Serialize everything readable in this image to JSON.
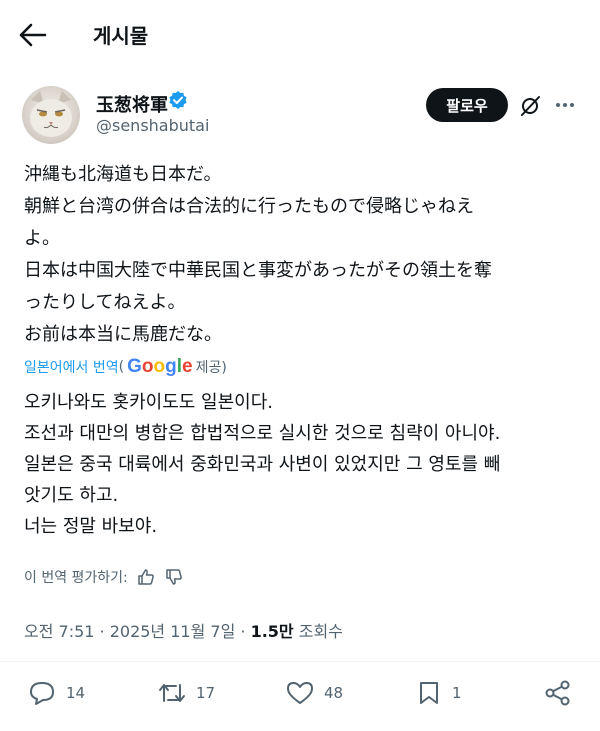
{
  "header": {
    "title": "게시물",
    "back_icon": "arrow-left-icon"
  },
  "author": {
    "name": "玉葱将軍",
    "handle": "@senshabutai",
    "verified_color": "#1d9bf0",
    "follow_label": "팔로우"
  },
  "post": {
    "lines": [
      "沖縄も北海道も日本だ。",
      "朝鮮と台湾の併合は合法的に行ったもので侵略じゃねえ",
      "よ。",
      "日本は中国大陸で中華民国と事変があったがその領土を奪",
      "ったりしてねえよ。",
      "お前は本当に馬鹿だな。"
    ]
  },
  "translation": {
    "link": "일본어에서 번역",
    "open": "(",
    "provider": "Google",
    "suffix": "제공)",
    "lines": [
      "오키나와도 홋카이도도 일본이다.",
      "조선과 대만의 병합은 합법적으로 실시한 것으로 침략이 아니야.",
      "일본은 중국 대륙에서 중화민국과 사변이 있었지만 그 영토를 빼",
      "앗기도 하고.",
      "너는 정말 바보야."
    ],
    "rate_label": "이 번역 평가하기:"
  },
  "meta": {
    "time": "오전 7:51 · 2025년 11월 7일 · ",
    "views": "1.5만",
    "views_label": " 조회수"
  },
  "actions": {
    "replies": "14",
    "reposts": "17",
    "likes": "48",
    "bookmarks": "1"
  },
  "colors": {
    "text": "#0f1419",
    "secondary": "#536471",
    "accent": "#1d9bf0"
  }
}
